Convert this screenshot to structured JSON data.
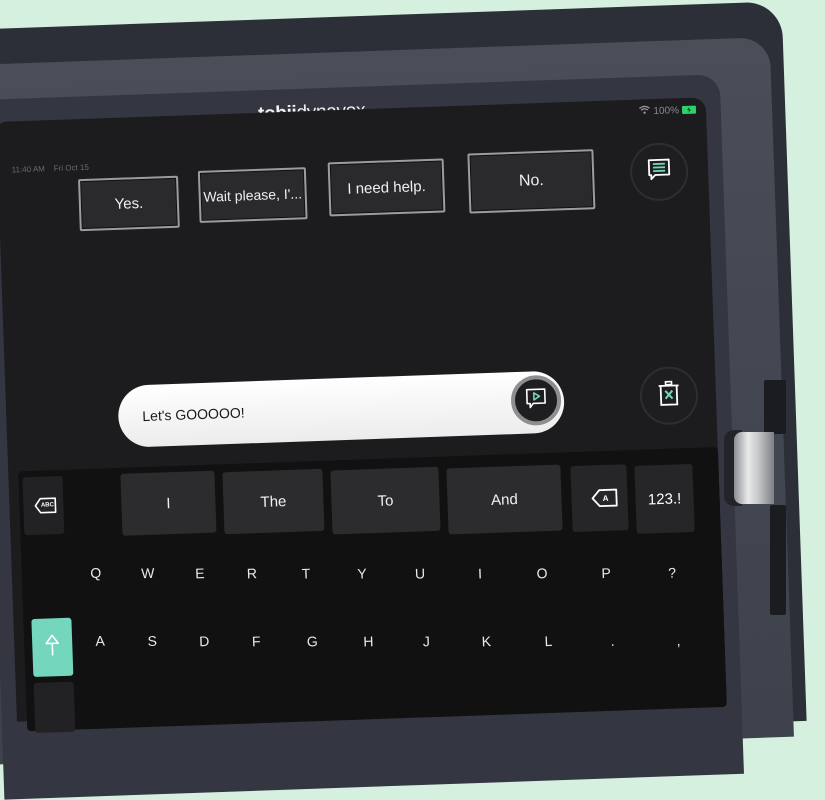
{
  "device": {
    "brand_bold": "tobii",
    "brand_regular": "dynavox"
  },
  "status_bar": {
    "time": "11:40 AM",
    "date": "Fri Oct 15",
    "battery_percent": "100%",
    "wifi_icon": "wifi-icon",
    "battery_icon": "battery-charging-icon"
  },
  "quick_phrases": [
    {
      "label": "Yes."
    },
    {
      "label": "Wait please, I'..."
    },
    {
      "label": "I need help."
    },
    {
      "label": "No."
    }
  ],
  "phrase_list_button": {
    "icon": "message-list-icon"
  },
  "message_bar": {
    "text": "Let's GOOOOO!",
    "speak_icon": "speak-message-icon"
  },
  "clear_button": {
    "icon": "trash-clear-icon"
  },
  "keyboard": {
    "abc_backspace_label": "ABC",
    "predictions": [
      "I",
      "The",
      "To",
      "And"
    ],
    "delete_letter_label": "A",
    "numbers_label": "123.!",
    "row1": [
      "Q",
      "W",
      "E",
      "R",
      "T",
      "Y",
      "U",
      "I",
      "O",
      "P",
      "?"
    ],
    "row2": [
      "A",
      "S",
      "D",
      "F",
      "G",
      "H",
      "J",
      "K",
      "L",
      ".",
      ","
    ],
    "shift_icon": "shift-arrow-icon"
  },
  "colors": {
    "accent": "#74d6bd",
    "background": "#d6f0e0",
    "screen": "#1c1c1e",
    "battery": "#2fd16a"
  }
}
